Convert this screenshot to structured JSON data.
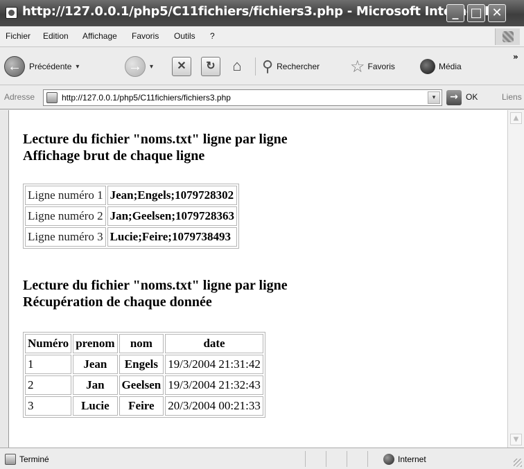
{
  "window": {
    "title": "http://127.0.0.1/php5/C11fichiers/fichiers3.php - Microsoft Internet E...",
    "minimize": "_",
    "maximize": "□",
    "close": "✕"
  },
  "menu": {
    "items": [
      "Fichier",
      "Edition",
      "Affichage",
      "Favoris",
      "Outils",
      "?"
    ]
  },
  "toolbar": {
    "back_label": "Précédente",
    "back_icon": "back-arrow-icon",
    "back_caret": "▾",
    "forward_caret": "▾",
    "search_label": "Rechercher",
    "favorites_label": "Favoris",
    "media_label": "Média",
    "overflow": "»"
  },
  "address": {
    "label": "Adresse",
    "url": "http://127.0.0.1/php5/C11fichiers/fichiers3.php",
    "dropdown": "▾",
    "go_arrow": "→",
    "go_label": "OK",
    "links_label": "Liens"
  },
  "content": {
    "section1": {
      "line1": "Lecture du fichier \"noms.txt\" ligne par ligne",
      "line2": "Affichage brut de chaque ligne",
      "rows": [
        {
          "label": "Ligne numéro 1",
          "value": "Jean;Engels;1079728302"
        },
        {
          "label": "Ligne numéro 2",
          "value": "Jan;Geelsen;1079728363"
        },
        {
          "label": "Ligne numéro 3",
          "value": "Lucie;Feire;1079738493"
        }
      ]
    },
    "section2": {
      "line1": "Lecture du fichier \"noms.txt\" ligne par ligne",
      "line2": "Récupération de chaque donnée",
      "headers": [
        "Numéro",
        "prenom",
        "nom",
        "date"
      ],
      "rows": [
        [
          "1",
          "Jean",
          "Engels",
          "19/3/2004 21:31:42"
        ],
        [
          "2",
          "Jan",
          "Geelsen",
          "19/3/2004 21:32:43"
        ],
        [
          "3",
          "Lucie",
          "Feire",
          "20/3/2004 00:21:33"
        ]
      ]
    }
  },
  "scroll": {
    "up": "▲",
    "down": "▼"
  },
  "status": {
    "text": "Terminé",
    "zone": "Internet"
  }
}
